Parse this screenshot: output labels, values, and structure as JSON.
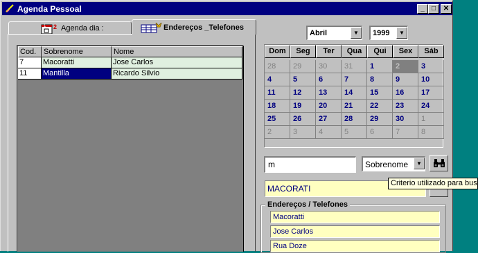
{
  "window": {
    "title": "Agenda Pessoal",
    "minimize": "_",
    "maximize": "□",
    "close": "✕"
  },
  "tabs": [
    {
      "label": "Agenda dia :",
      "active": false
    },
    {
      "label": "Endereços _Telefones",
      "active": true
    }
  ],
  "grid": {
    "columns": [
      "Cod.",
      "Sobrenome",
      "Nome"
    ],
    "rows": [
      {
        "cod": "7",
        "sobrenome": "Macoratti",
        "nome": "Jose Carlos"
      },
      {
        "cod": "11",
        "sobrenome": "Mantilla",
        "nome": "Ricardo Silvio"
      }
    ]
  },
  "calendar": {
    "month": "Abril",
    "year": "1999",
    "weekdays": [
      "Dom",
      "Seg",
      "Ter",
      "Qua",
      "Qui",
      "Sex",
      "Sáb"
    ],
    "weeks": [
      [
        "28",
        "29",
        "30",
        "31",
        "1",
        "2",
        "3"
      ],
      [
        "4",
        "5",
        "6",
        "7",
        "8",
        "9",
        "10"
      ],
      [
        "11",
        "12",
        "13",
        "14",
        "15",
        "16",
        "17"
      ],
      [
        "18",
        "19",
        "20",
        "21",
        "22",
        "23",
        "24"
      ],
      [
        "25",
        "26",
        "27",
        "28",
        "29",
        "30",
        "1"
      ],
      [
        "2",
        "3",
        "4",
        "5",
        "6",
        "7",
        "8"
      ]
    ]
  },
  "search": {
    "value": "m",
    "criteria": "Sobrenome",
    "tooltip": "Criterio utilizado para busca"
  },
  "result": {
    "value": "MACORATI"
  },
  "address_group": {
    "legend": "Endereços / Telefones",
    "fields": [
      "Macoratti",
      "Jose Carlos",
      "Rua Doze"
    ]
  },
  "colors": {
    "titlebar": "#000080",
    "field_highlight": "#ffffc0",
    "calendar_day": "#000080",
    "desktop": "#008080"
  }
}
